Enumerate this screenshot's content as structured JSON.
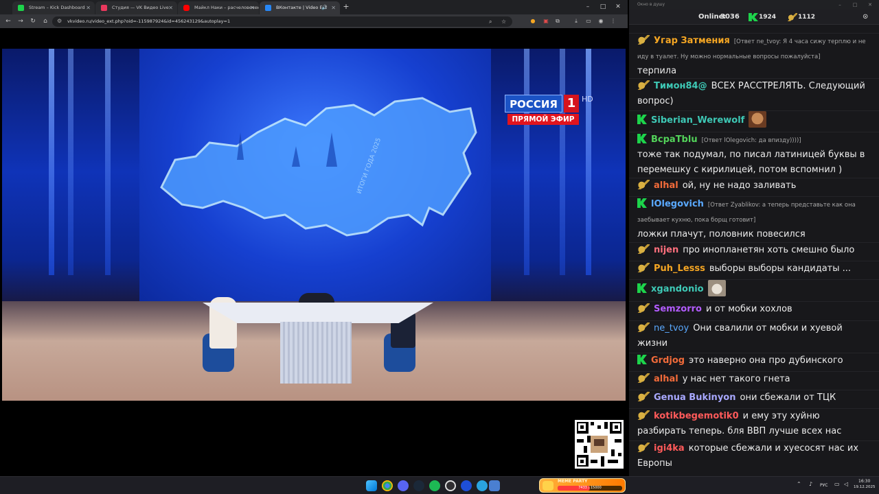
{
  "browser": {
    "tabs": [
      {
        "title": "Stream – Kick Dashboard",
        "icon": "kick-icon",
        "color": "#1dd34b",
        "active": false
      },
      {
        "title": "Студия — VK Видео Live",
        "icon": "vk-video-icon",
        "color": "#e8385d",
        "active": false
      },
      {
        "title": "Майкл Наки – расчеловечение",
        "icon": "youtube-icon",
        "color": "#ff0000",
        "active": false
      },
      {
        "title": "ВКонтакте | Video Ext",
        "icon": "vk-icon",
        "color": "#2787f5",
        "active": true
      }
    ],
    "new_tab": "+",
    "window_controls": {
      "minimize": "–",
      "maximize": "□",
      "close": "✕"
    },
    "nav": {
      "back": "←",
      "forward": "→",
      "reload": "↻",
      "home": "⌂"
    },
    "url": "vkvideo.ru/video_ext.php?oid=-115987924&id=456243129&autoplay=1"
  },
  "video": {
    "channel": {
      "name": "РОССИЯ",
      "number": "1",
      "hd": "HD",
      "live": "ПРЯМОЙ ЭФИР"
    },
    "backdrop_text": "ИТОГИ ГОДА 2025"
  },
  "chat": {
    "window_title": "Окно в душу",
    "online_label": "Online:",
    "online_count": "3036",
    "kick_viewers": "1924",
    "vk_viewers": "1112",
    "messages": [
      {
        "platform": "vk",
        "user": "Угар Затмения",
        "color": "#f5a623",
        "reply": "[Ответ ne_tvoy: Я 4 часа сижу терплю и не иду в туалет. Ну можно нормальные вопросы пожалуйста]",
        "text": "терпила"
      },
      {
        "platform": "vk",
        "user": "Тимон84@",
        "color": "#3ec9b6",
        "reply": "",
        "text": "ВСЕХ РАССТРЕЛЯТЬ. Следующий вопрос)"
      },
      {
        "platform": "kick",
        "user": "Siberian_Werewolf",
        "color": "#3ec9b6",
        "reply": "",
        "text": "",
        "emote": "laughing-emote"
      },
      {
        "platform": "kick",
        "user": "ВсраТblu",
        "color": "#53d35a",
        "reply": "[Ответ lOlegovich: да впизду))))]",
        "text": "тоже так подумал, по писал латиницей буквы в перемешку с кирилицей, потом вспомнил )"
      },
      {
        "platform": "vk",
        "user": "alhal",
        "color": "#f26b3a",
        "reply": "",
        "text": "ой, ну не надо заливать"
      },
      {
        "platform": "kick",
        "user": "lOlegovich",
        "color": "#5aa9ff",
        "reply": "[Ответ Zyablikov: а теперь представьте как она заебывает кухню, пока борщ готовит]",
        "text": "ложки плачут, половник повесился"
      },
      {
        "platform": "vk",
        "user": "nijen",
        "color": "#ff6f7d",
        "reply": "",
        "text": "про инопланетян хоть смешно было"
      },
      {
        "platform": "vk",
        "user": "Puh_Lesss",
        "color": "#f5a623",
        "reply": "",
        "text": "выборы выборы кандидаты ..."
      },
      {
        "platform": "kick",
        "user": "xgandonio",
        "color": "#3ec9b6",
        "reply": "",
        "text": "",
        "emote": "cat-emote"
      },
      {
        "platform": "vk",
        "user": "Semzorro",
        "color": "#b35cff",
        "reply": "",
        "text": "и от мобки хохлов"
      },
      {
        "platform": "vk",
        "user": "ne_tvoy",
        "color": "#5aa9ff",
        "reply": "",
        "text": "Они свалили от мобки и хуевой жизни"
      },
      {
        "platform": "kick",
        "user": "Grdjog",
        "color": "#f26b3a",
        "reply": "",
        "text": "это наверно она про дубинского"
      },
      {
        "platform": "vk",
        "user": "alhal",
        "color": "#f26b3a",
        "reply": "",
        "text": "у нас нет такого гнета"
      },
      {
        "platform": "vk",
        "user": "Genua Bukinyon",
        "color": "#a8a8ff",
        "reply": "",
        "text": "они сбежали от ТЦК"
      },
      {
        "platform": "vk",
        "user": "kotikbegemotik0",
        "color": "#ff5a5a",
        "reply": "",
        "text": "и ему эту хуйню разбирать теперь. бля ВВП лучше всех нас"
      },
      {
        "platform": "vk",
        "user": "igi4ka",
        "color": "#ff5a5a",
        "reply": "",
        "text": "которые сбежали и хуесосят нас их Европы"
      }
    ]
  },
  "taskbar": {
    "meme_widget": {
      "label": "MEME PARTY",
      "progress_text": "7433 / 15000",
      "progress_fraction": 0.5
    },
    "language": "РУС",
    "time": "16:30",
    "date": "19.12.2025",
    "apps": [
      "windows-start-icon",
      "chrome-icon",
      "discord-icon",
      "steam-icon",
      "spotify-icon",
      "obs-icon",
      "media-player-icon",
      "telegram-icon",
      "app-icon"
    ]
  }
}
